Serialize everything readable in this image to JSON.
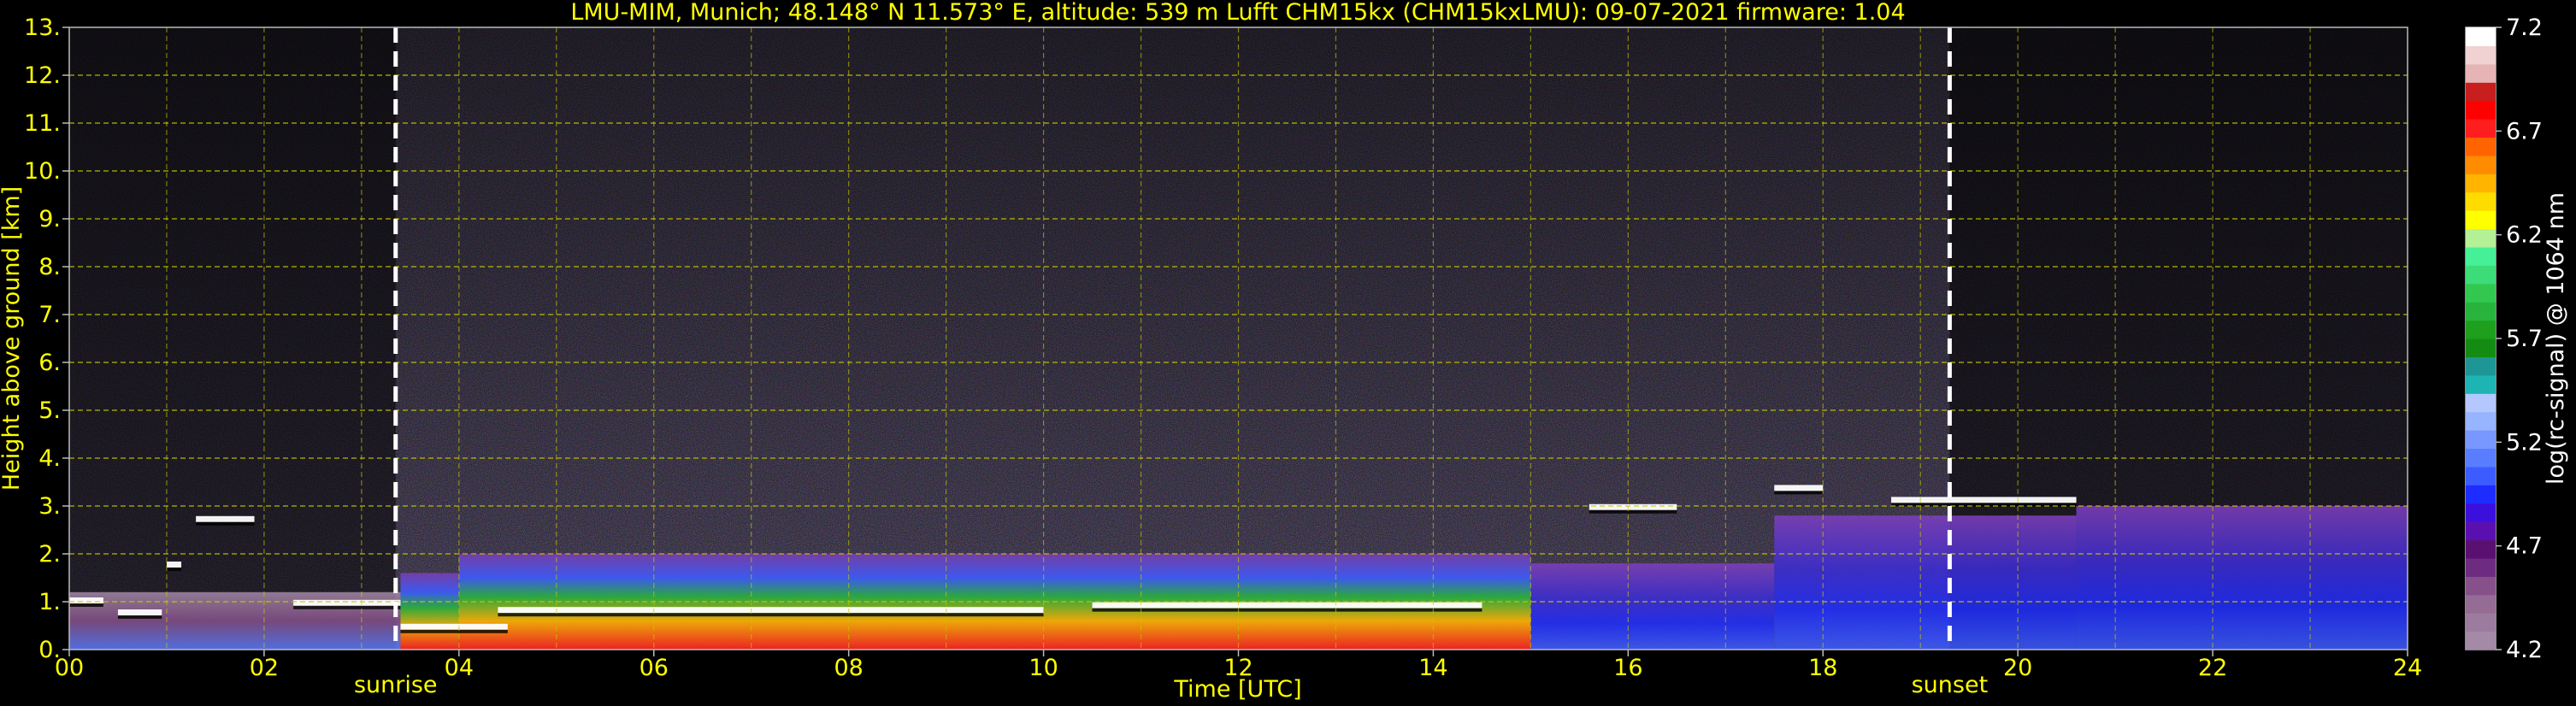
{
  "chart_data": {
    "type": "heatmap",
    "title": "LMU-MIM, Munich; 48.148° N 11.573° E, altitude: 539 m    Lufft CHM15kx (CHM15kxLMU): 09-07-2021    firmware: 1.04",
    "xlabel": "Time [UTC]",
    "ylabel": "Height above ground [km]",
    "xlim": [
      0,
      24
    ],
    "ylim": [
      0,
      13
    ],
    "x_ticks": [
      "00",
      "02",
      "04",
      "06",
      "08",
      "10",
      "12",
      "14",
      "16",
      "18",
      "20",
      "22",
      "24"
    ],
    "y_ticks": [
      "0.",
      "1.",
      "2.",
      "3.",
      "4.",
      "5.",
      "6.",
      "7.",
      "8.",
      "9.",
      "10.",
      "11.",
      "12.",
      "13."
    ],
    "grid": true,
    "colorbar": {
      "label": "log(rc-signal) @ 1064 nm",
      "range": [
        4.2,
        7.2
      ],
      "ticks": [
        "4.2",
        "4.7",
        "5.2",
        "5.7",
        "6.2",
        "6.7",
        "7.2"
      ],
      "colors": [
        "#a48aa6",
        "#9c7c9e",
        "#946c94",
        "#86508a",
        "#6e2c80",
        "#5a1070",
        "#5a10b0",
        "#3c10dc",
        "#1e2cff",
        "#3c5cff",
        "#5a7cff",
        "#7898ff",
        "#96b4ff",
        "#b4c8ff",
        "#1eb4b4",
        "#1e9696",
        "#148c14",
        "#1ea01e",
        "#28b43c",
        "#32c850",
        "#3cdc78",
        "#46f096",
        "#b4f096",
        "#ffff00",
        "#ffdc00",
        "#ffb400",
        "#ff8c00",
        "#ff6400",
        "#ff1e1e",
        "#ff0000",
        "#c81e1e",
        "#e6b4b4",
        "#f0d2d2",
        "#ffffff"
      ]
    },
    "events": [
      {
        "label": "sunrise",
        "time_utc": 3.35
      },
      {
        "label": "sunset",
        "time_utc": 19.3
      }
    ],
    "cloud_layers": [
      {
        "start": 0.0,
        "end": 0.35,
        "height_km": 1.0
      },
      {
        "start": 0.5,
        "end": 0.95,
        "height_km": 0.75
      },
      {
        "start": 1.0,
        "end": 1.15,
        "height_km": 1.75
      },
      {
        "start": 1.3,
        "end": 1.9,
        "height_km": 2.7
      },
      {
        "start": 2.3,
        "end": 3.4,
        "height_km": 0.95
      },
      {
        "start": 3.4,
        "end": 4.5,
        "height_km": 0.45
      },
      {
        "start": 4.4,
        "end": 10.0,
        "height_km": 0.8
      },
      {
        "start": 10.5,
        "end": 14.5,
        "height_km": 0.9
      },
      {
        "start": 15.6,
        "end": 16.5,
        "height_km": 2.95
      },
      {
        "start": 17.5,
        "end": 18.0,
        "height_km": 3.35
      },
      {
        "start": 18.7,
        "end": 20.6,
        "height_km": 3.1
      }
    ],
    "aerosol_layer_top_km": [
      {
        "start": 0,
        "end": 3.4,
        "value": 1.2
      },
      {
        "start": 3.4,
        "end": 4.0,
        "value": 1.6
      },
      {
        "start": 4.0,
        "end": 15.0,
        "value": 2.0
      },
      {
        "start": 15.0,
        "end": 17.5,
        "value": 1.8
      },
      {
        "start": 17.5,
        "end": 20.6,
        "value": 2.8
      },
      {
        "start": 20.6,
        "end": 24.0,
        "value": 3.0
      }
    ]
  }
}
